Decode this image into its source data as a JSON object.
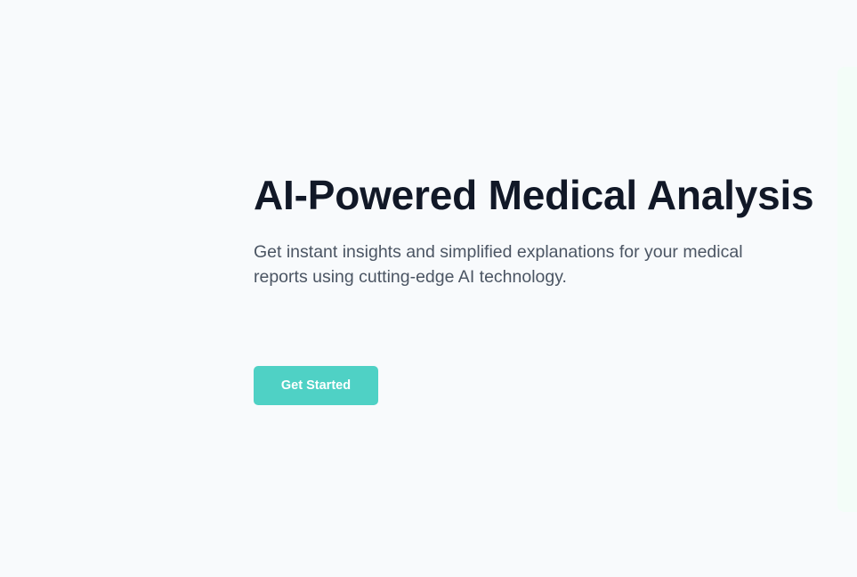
{
  "hero": {
    "title": "AI-Powered Medical Analysis",
    "subtitle": "Get instant insights and simplified explanations for your medical reports using cutting-edge AI technology.",
    "cta_label": "Get Started"
  },
  "colors": {
    "background": "#f8fafc",
    "title": "#111827",
    "subtitle": "#4b5563",
    "accent": "#4fd1c5",
    "side_panel": "#f3fdf8"
  }
}
